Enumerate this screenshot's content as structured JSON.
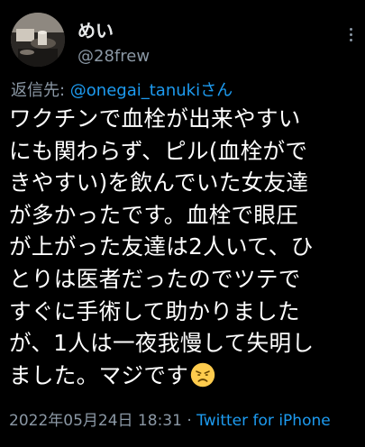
{
  "user": {
    "display_name": "めい",
    "handle": "@28frew",
    "avatar_icon": "avatar-photo"
  },
  "reply": {
    "prefix": "返信先: ",
    "mention": "@onegai_tanukiさん"
  },
  "tweet": {
    "lines": [
      "ワクチンで血栓が出来やすい",
      "にも関わらず、ピル(血栓がで",
      "きやすい)を飲んでいた女友達",
      "が多かったです。血栓で眼圧",
      "が上がった友達は2人いて、ひ",
      "とりは医者だったのでツテで",
      "すぐに手術して助かりました",
      "が、1人は一夜我慢して失明し",
      "ました。マジです"
    ],
    "emoji": "disappointed-face-emoji"
  },
  "meta": {
    "timestamp": "2022年05月24日 18:31",
    "separator": " · ",
    "source": "Twitter for iPhone"
  },
  "colors": {
    "background": "#000000",
    "text": "#ffffff",
    "secondary": "#8b98a5",
    "link": "#1d9bf0"
  }
}
